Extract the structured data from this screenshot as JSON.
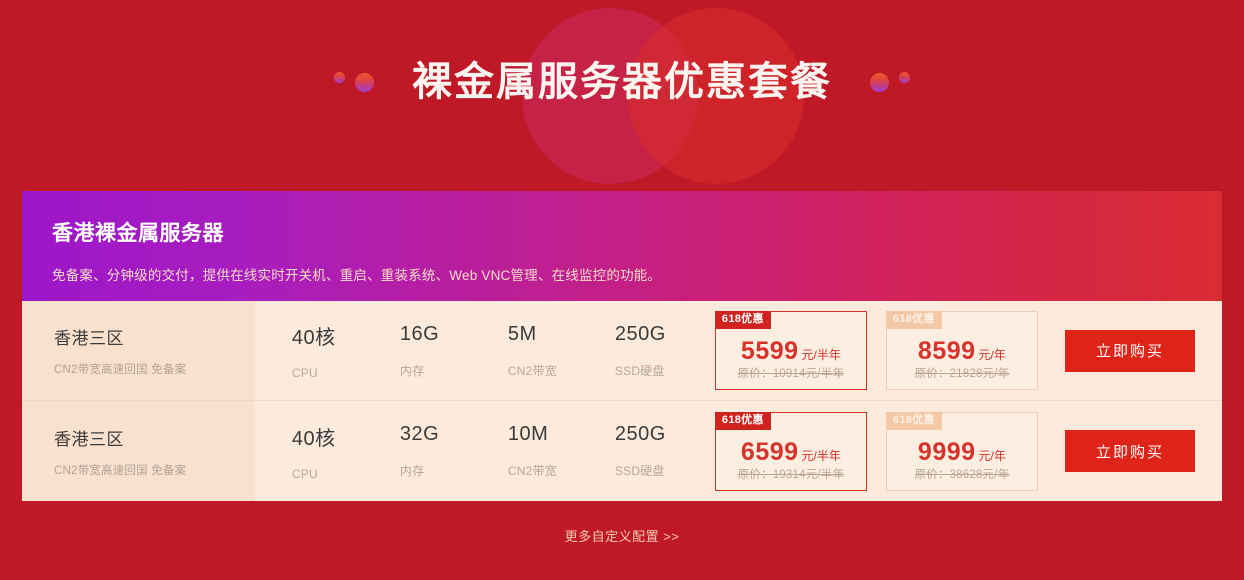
{
  "hero": {
    "title": "裸金属服务器优惠套餐",
    "dot_icon_left_small": "decorative-dot",
    "dot_icon_left_large": "decorative-dot",
    "dot_icon_right_large": "decorative-dot",
    "dot_icon_right_small": "decorative-dot"
  },
  "card": {
    "header": {
      "title": "香港裸金属服务器",
      "subtitle": "免备案、分钟级的交付，提供在线实时开关机、重启、重装系统、Web VNC管理、在线监控的功能。"
    },
    "rows": [
      {
        "name": "香港三区",
        "name_sub": "CN2带宽高速回国 免备案",
        "specs": [
          {
            "value": "40核",
            "label": "CPU"
          },
          {
            "value": "16G",
            "label": "内存"
          },
          {
            "value": "5M",
            "label": "CN2带宽"
          },
          {
            "value": "250G",
            "label": "SSD硬盘"
          }
        ],
        "prices": [
          {
            "badge": "618优惠",
            "badge_active": true,
            "amount": "5599",
            "unit": "元/半年",
            "original": "原价：10914元/半年"
          },
          {
            "badge": "618优惠",
            "badge_active": false,
            "amount": "8599",
            "unit": "元/年",
            "original": "原价：21828元/年"
          }
        ],
        "buy_label": "立即购买"
      },
      {
        "name": "香港三区",
        "name_sub": "CN2带宽高速回国 免备案",
        "specs": [
          {
            "value": "40核",
            "label": "CPU"
          },
          {
            "value": "32G",
            "label": "内存"
          },
          {
            "value": "10M",
            "label": "CN2带宽"
          },
          {
            "value": "250G",
            "label": "SSD硬盘"
          }
        ],
        "prices": [
          {
            "badge": "618优惠",
            "badge_active": true,
            "amount": "6599",
            "unit": "元/半年",
            "original": "原价：19314元/半年"
          },
          {
            "badge": "618优惠",
            "badge_active": false,
            "amount": "9999",
            "unit": "元/年",
            "original": "原价：38628元/年"
          }
        ],
        "buy_label": "立即购买"
      }
    ]
  },
  "footer": {
    "more_link": "更多自定义配置 >>"
  },
  "colors": {
    "page_background": "#bf1827",
    "header_gradient_start": "#9c17c9",
    "header_gradient_end": "#d92c33",
    "row_background": "#fcebdd",
    "name_column_background": "#f9e1cd",
    "price_red": "#d6332c",
    "badge_active": "#d0221f",
    "badge_inactive": "#f3c8a6",
    "buy_button": "#de2318",
    "muted_text": "#b5a79b"
  }
}
